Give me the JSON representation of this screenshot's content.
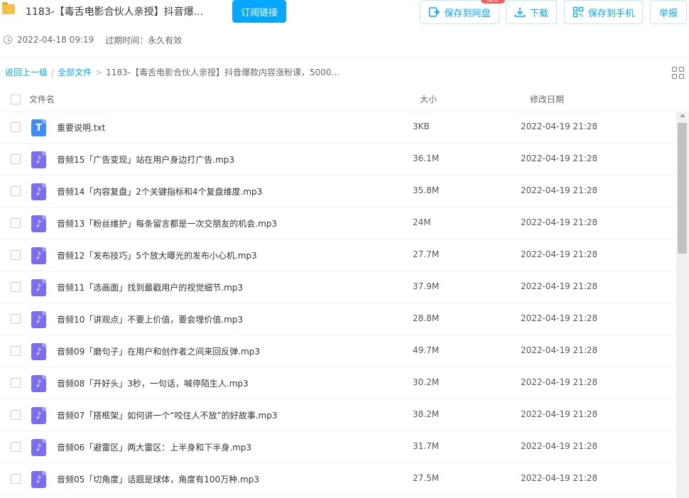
{
  "header": {
    "title": "1183-【毒舌电影合伙人亲授】抖音爆...",
    "subscribe_label": "订阅链接",
    "actions": {
      "save_disk": "保存到网盘",
      "download": "下载",
      "save_phone": "保存到手机",
      "report": "举报"
    },
    "badge": "限免"
  },
  "meta": {
    "created": "2022-04-18 09:19",
    "expire": "过期时间：永久有效"
  },
  "breadcrumb": {
    "back": "返回上一级",
    "sep1": "|",
    "all": "全部文件",
    "sep2": ">",
    "current": "1183-【毒舌电影合伙人亲授】抖音爆款内容涨粉课，5000..."
  },
  "columns": {
    "name": "文件名",
    "size": "大小",
    "date": "修改日期"
  },
  "files": [
    {
      "type": "txt",
      "icon": "T",
      "name": "重要说明.txt",
      "size": "3KB",
      "date": "2022-04-19 21:28"
    },
    {
      "type": "mp3",
      "icon": "♪",
      "name": "音频15「广告变现」站在用户身边打广告.mp3",
      "size": "36.1M",
      "date": "2022-04-19 21:28"
    },
    {
      "type": "mp3",
      "icon": "♪",
      "name": "音频14「内容复盘」2个关键指标和4个复盘维度.mp3",
      "size": "35.8M",
      "date": "2022-04-19 21:28"
    },
    {
      "type": "mp3",
      "icon": "♪",
      "name": "音频13「粉丝维护」每条留言都是一次交朋友的机会.mp3",
      "size": "24M",
      "date": "2022-04-19 21:28"
    },
    {
      "type": "mp3",
      "icon": "♪",
      "name": "音频12「发布技巧」5个放大曝光的发布小心机.mp3",
      "size": "27.7M",
      "date": "2022-04-19 21:28"
    },
    {
      "type": "mp3",
      "icon": "♪",
      "name": "音频11「选画面」找到最戳用户的视觉细节.mp3",
      "size": "37.9M",
      "date": "2022-04-19 21:28"
    },
    {
      "type": "mp3",
      "icon": "♪",
      "name": "音频10「讲观点」不要上价值，要会埋价值.mp3",
      "size": "28.8M",
      "date": "2022-04-19 21:28"
    },
    {
      "type": "mp3",
      "icon": "♪",
      "name": "音频09「磨句子」在用户和创作者之间来回反弹.mp3",
      "size": "49.7M",
      "date": "2022-04-19 21:28"
    },
    {
      "type": "mp3",
      "icon": "♪",
      "name": "音频08「开好头」3秒，一句话，喊停陌生人.mp3",
      "size": "30.2M",
      "date": "2022-04-19 21:28"
    },
    {
      "type": "mp3",
      "icon": "♪",
      "name": "音频07「搭框架」如何讲一个“咬住人不放”的好故事.mp3",
      "size": "38.2M",
      "date": "2022-04-19 21:28"
    },
    {
      "type": "mp3",
      "icon": "♪",
      "name": "音频06「避雷区」两大雷区：上半身和下半身.mp3",
      "size": "31.7M",
      "date": "2022-04-19 21:28"
    },
    {
      "type": "mp3",
      "icon": "♪",
      "name": "音频05「切角度」话题是球体，角度有100万种.mp3",
      "size": "27.5M",
      "date": "2022-04-19 21:28"
    }
  ]
}
